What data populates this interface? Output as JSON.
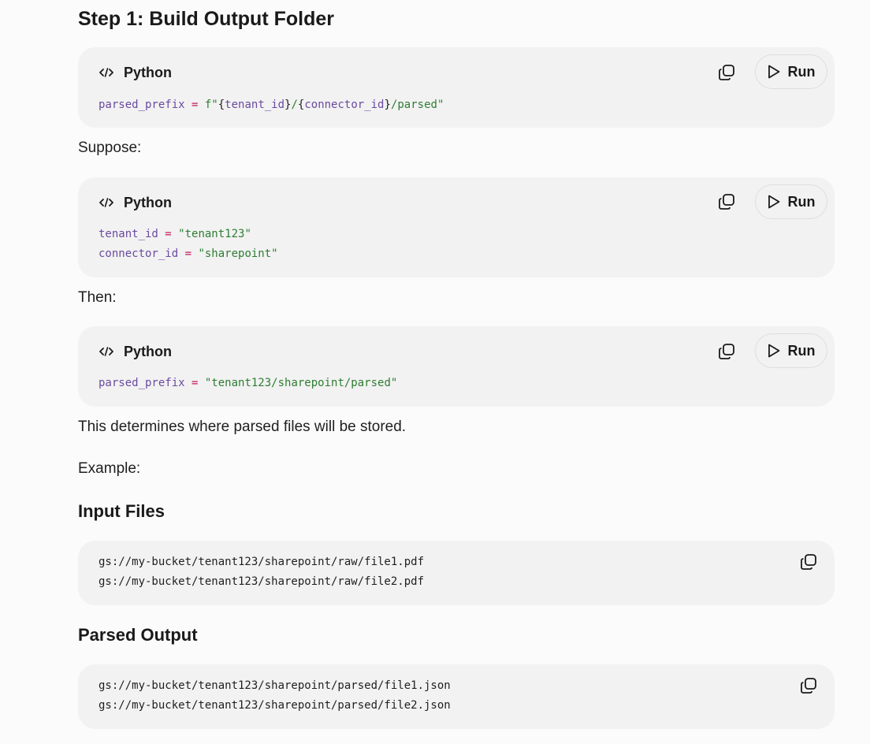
{
  "sections": {
    "step1_heading": "Step 1: Build Output Folder",
    "suppose_text": "Suppose:",
    "then_text": "Then:",
    "determines_text": "This determines where parsed files will be stored.",
    "example_text": "Example:",
    "input_heading": "Input Files",
    "parsed_heading": "Parsed Output"
  },
  "code_blocks": [
    {
      "language": "Python",
      "run_label": "Run",
      "lines": [
        [
          {
            "text": "parsed_prefix",
            "kind": "var"
          },
          {
            "text": " = ",
            "kind": "op"
          },
          {
            "text": "f\"",
            "kind": "str"
          },
          {
            "text": "{",
            "kind": "plain"
          },
          {
            "text": "tenant_id",
            "kind": "var"
          },
          {
            "text": "}",
            "kind": "plain"
          },
          {
            "text": "/",
            "kind": "str"
          },
          {
            "text": "{",
            "kind": "plain"
          },
          {
            "text": "connector_id",
            "kind": "var"
          },
          {
            "text": "}",
            "kind": "plain"
          },
          {
            "text": "/parsed\"",
            "kind": "str"
          }
        ]
      ]
    },
    {
      "language": "Python",
      "run_label": "Run",
      "lines": [
        [
          {
            "text": "tenant_id",
            "kind": "var"
          },
          {
            "text": " = ",
            "kind": "op"
          },
          {
            "text": "\"tenant123\"",
            "kind": "str"
          }
        ],
        [
          {
            "text": "connector_id",
            "kind": "var"
          },
          {
            "text": " = ",
            "kind": "op"
          },
          {
            "text": "\"sharepoint\"",
            "kind": "str"
          }
        ]
      ]
    },
    {
      "language": "Python",
      "run_label": "Run",
      "lines": [
        [
          {
            "text": "parsed_prefix",
            "kind": "var"
          },
          {
            "text": " = ",
            "kind": "op"
          },
          {
            "text": "\"tenant123/sharepoint/parsed\"",
            "kind": "str"
          }
        ]
      ]
    }
  ],
  "plain_blocks": {
    "input_files": [
      "gs://my-bucket/tenant123/sharepoint/raw/file1.pdf",
      "gs://my-bucket/tenant123/sharepoint/raw/file2.pdf"
    ],
    "parsed_output": [
      "gs://my-bucket/tenant123/sharepoint/parsed/file1.json",
      "gs://my-bucket/tenant123/sharepoint/parsed/file2.json"
    ]
  },
  "icons": {
    "language": "code-icon",
    "copy": "copy-icon",
    "run": "play-icon"
  },
  "colors": {
    "background": "#fbfbfb",
    "card": "#f2f2f2",
    "variable": "#6b4aa0",
    "operator": "#c2185b",
    "string": "#2e7d32"
  }
}
